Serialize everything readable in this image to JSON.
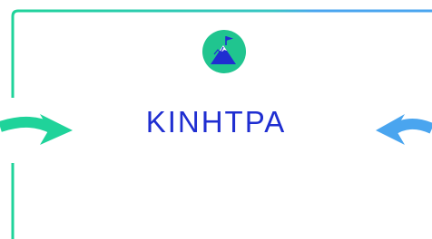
{
  "brand": {
    "wordmark": "KINHTPA",
    "logo_icon": "mountain-flag-icon",
    "colors": {
      "wordmark": "#1f2ed1",
      "badge": "#20c58f",
      "mountain": "#1f2ed1"
    }
  },
  "decor": {
    "left_arrow_icon": "arrow-right-icon",
    "right_arrow_icon": "arrow-left-icon",
    "colors": {
      "green": "#1fd39a",
      "blue": "#4aa5ef"
    }
  }
}
